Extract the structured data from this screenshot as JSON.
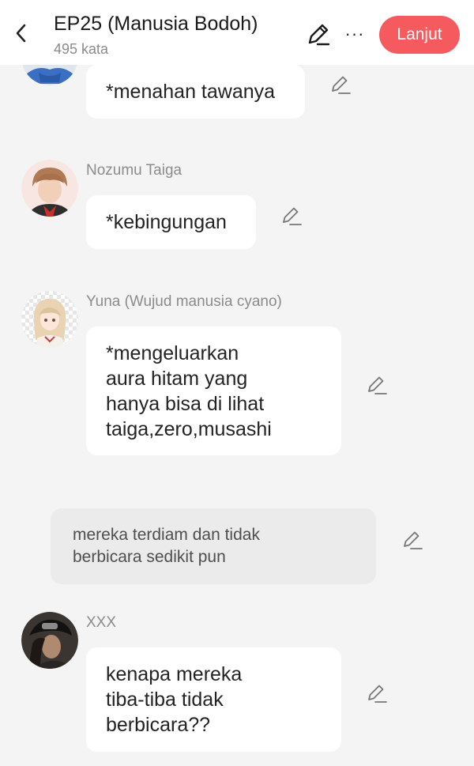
{
  "header": {
    "title": "EP25 (Manusia Bodoh)",
    "word_count": "495 kata",
    "next_label": "Lanjut",
    "more_label": "···",
    "accent_color": "#f55a5f"
  },
  "messages": [
    {
      "type": "dialogue",
      "speaker": "",
      "text": "*menahan tawanya"
    },
    {
      "type": "dialogue",
      "speaker": "Nozumu Taiga",
      "text": "*kebingungan"
    },
    {
      "type": "dialogue",
      "speaker": "Yuna (Wujud manusia cyano)",
      "text": "*mengeluarkan\naura hitam yang\nhanya bisa di lihat\ntaiga,zero,musashi"
    },
    {
      "type": "narration",
      "text": "mereka terdiam dan tidak\nberbicara sedikit pun"
    },
    {
      "type": "dialogue",
      "speaker": "XXX",
      "text": "kenapa mereka\ntiba-tiba tidak\nberbicara??"
    }
  ]
}
